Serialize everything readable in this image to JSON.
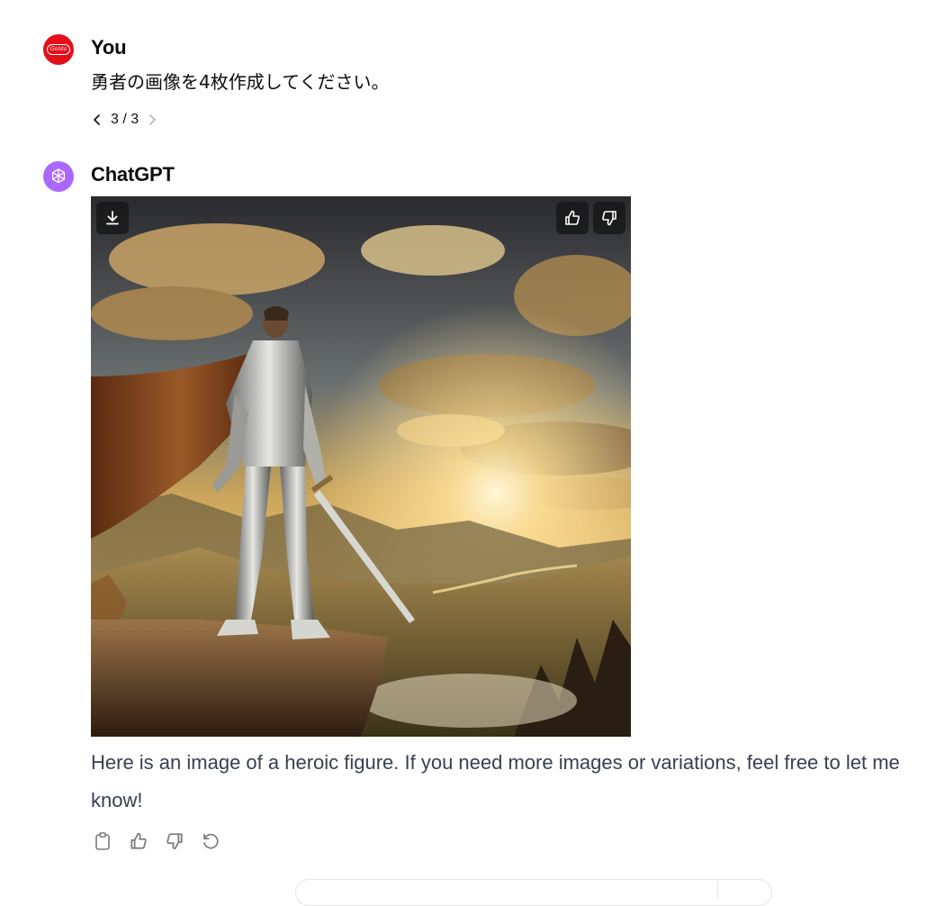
{
  "user_message": {
    "author": "You",
    "avatar_badge": "Gonta",
    "text": "勇者の画像を4枚作成してください。",
    "pager": {
      "current": "3 / 3",
      "prev_icon": "chevron-left-icon",
      "next_icon": "chevron-right-icon"
    }
  },
  "assistant_message": {
    "author": "ChatGPT",
    "avatar_icon": "openai-logo-icon",
    "image": {
      "icons": [
        "download-icon",
        "thumbs-up-icon",
        "thumbs-down-icon"
      ]
    },
    "text": "Here is an image of a heroic figure. If you need more images or variations, feel free to let me know!",
    "actions": [
      "copy-icon",
      "thumbs-up-icon",
      "thumbs-down-icon",
      "regenerate-icon"
    ]
  },
  "colors": {
    "user_avatar": "#e3101a",
    "assistant_avatar": "#ab68ff",
    "reply_text": "#374151"
  }
}
